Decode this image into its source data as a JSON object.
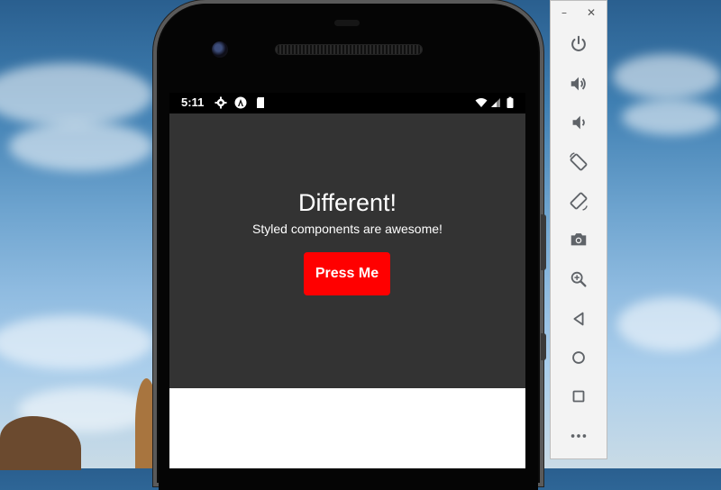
{
  "status_bar": {
    "time": "5:11"
  },
  "app": {
    "title": "Different!",
    "subtitle": "Styled components are awesome!",
    "button_label": "Press Me",
    "background_color": "#333333",
    "button_color": "#ff0000"
  },
  "emulator_toolbar": {
    "window_controls": [
      "minimize-icon",
      "close-icon"
    ],
    "buttons": [
      "power-icon",
      "volume-up-icon",
      "volume-down-icon",
      "rotate-left-icon",
      "rotate-right-icon",
      "camera-icon",
      "zoom-icon",
      "back-icon",
      "home-icon",
      "overview-icon",
      "more-icon"
    ]
  }
}
